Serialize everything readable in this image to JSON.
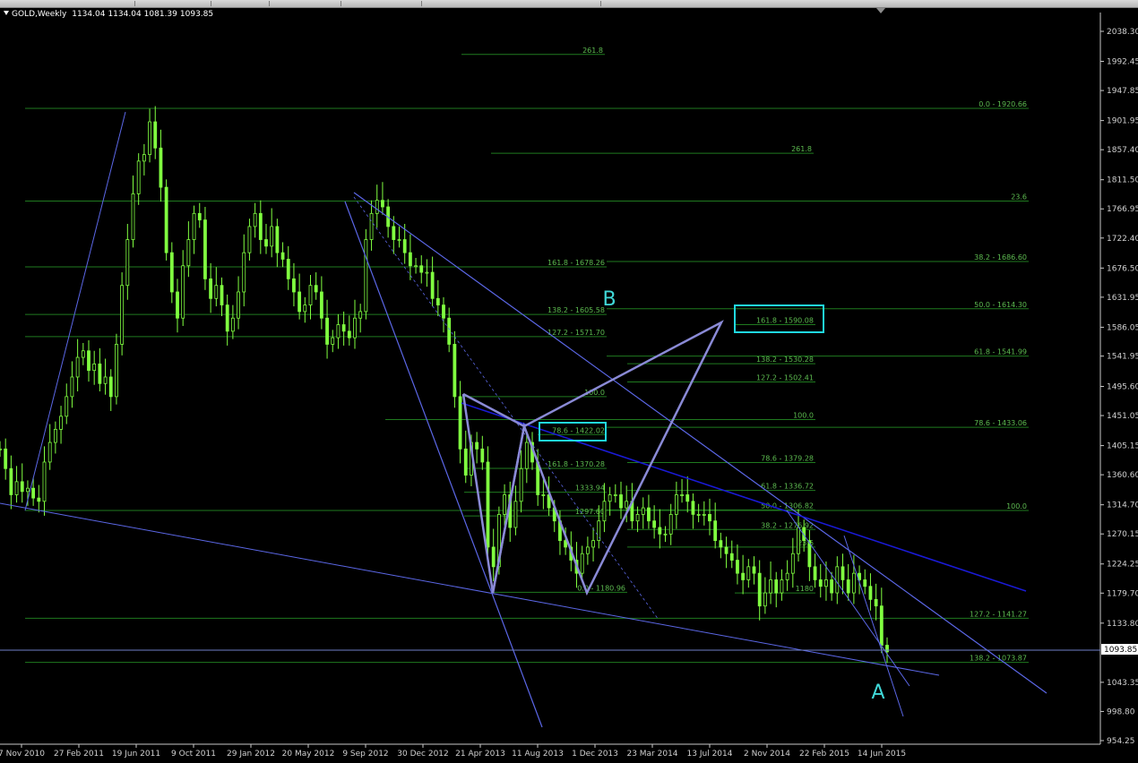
{
  "header": {
    "symbol": "GOLD,Weekly",
    "open": "1134.04",
    "high": "1134.04",
    "low": "1081.39",
    "close": "1093.85"
  },
  "colors": {
    "background": "#000000",
    "candles": "#80ff40",
    "fib": "#1f7a1f",
    "fib_text": "#5dbb50",
    "trendline": "#5b67e6",
    "trendline_dark": "#1a1ad6",
    "pattern": "#8a8ad6",
    "highlight_box": "#20d8e0",
    "label_text": "#40d8d8",
    "price_line": "#6f7fc8",
    "axis_text": "#d0d0d0"
  },
  "chart_data": {
    "type": "candlestick",
    "instrument": "GOLD",
    "timeframe": "Weekly",
    "ylim": [
      954.25,
      2050
    ],
    "y_ticks": [
      "2038.30",
      "1992.45",
      "1947.85",
      "1901.95",
      "1857.40",
      "1811.50",
      "1766.95",
      "1722.40",
      "1676.50",
      "1631.95",
      "1586.05",
      "1541.95",
      "1495.60",
      "1451.05",
      "1405.15",
      "1360.60",
      "1314.70",
      "1270.15",
      "1224.25",
      "1179.70",
      "1133.80",
      "1093.85",
      "1043.35",
      "998.80",
      "954.25"
    ],
    "x_ticks": [
      "7 Nov 2010",
      "27 Feb 2011",
      "19 Jun 2011",
      "9 Oct 2011",
      "29 Jan 2012",
      "20 May 2012",
      "9 Sep 2012",
      "30 Dec 2012",
      "21 Apr 2013",
      "11 Aug 2013",
      "1 Dec 2013",
      "23 Mar 2014",
      "13 Jul 2014",
      "2 Nov 2014",
      "22 Feb 2015",
      "14 Jun 2015"
    ],
    "current_price": "1093.85",
    "series": [
      {
        "values": [
          1400,
          1370,
          1330,
          1350,
          1335,
          1340,
          1325,
          1320,
          1380,
          1410,
          1430,
          1450,
          1480,
          1510,
          1540,
          1550,
          1520,
          1530,
          1500,
          1510,
          1480,
          1560,
          1650,
          1720,
          1790,
          1840,
          1850,
          1900,
          1860,
          1800,
          1700,
          1640,
          1600,
          1680,
          1720,
          1760,
          1750,
          1660,
          1630,
          1650,
          1620,
          1580,
          1600,
          1640,
          1700,
          1740,
          1760,
          1720,
          1710,
          1740,
          1700,
          1690,
          1660,
          1640,
          1610,
          1620,
          1650,
          1640,
          1600,
          1560,
          1570,
          1590,
          1580,
          1570,
          1600,
          1610,
          1720,
          1760,
          1780,
          1770,
          1740,
          1720,
          1720,
          1700,
          1680,
          1680,
          1670,
          1670,
          1630,
          1620,
          1600,
          1560,
          1480,
          1400,
          1360,
          1410,
          1400,
          1380,
          1250,
          1220,
          1300,
          1330,
          1280,
          1320,
          1370,
          1410,
          1380,
          1330,
          1330,
          1310,
          1290,
          1260,
          1250,
          1230,
          1210,
          1240,
          1250,
          1260,
          1290,
          1320,
          1330,
          1330,
          1310,
          1320,
          1290,
          1300,
          1310,
          1290,
          1280,
          1270,
          1270,
          1300,
          1330,
          1330,
          1320,
          1300,
          1300,
          1300,
          1290,
          1260,
          1250,
          1240,
          1230,
          1210,
          1200,
          1220,
          1210,
          1160,
          1180,
          1200,
          1180,
          1200,
          1210,
          1240,
          1280,
          1260,
          1220,
          1200,
          1190,
          1200,
          1180,
          1220,
          1200,
          1180,
          1210,
          1200,
          1190,
          1170,
          1160,
          1100,
          1090
        ]
      }
    ],
    "fib_levels": [
      {
        "label": "261.8",
        "price": 2003
      },
      {
        "label": "0.0 - 1920.66",
        "price": 1920.66
      },
      {
        "label": "261.8",
        "price": 1852
      },
      {
        "label": "23.6",
        "price": 1779
      },
      {
        "label": "161.8 - 1678.26",
        "price": 1678.26
      },
      {
        "label": "38.2 - 1686.60",
        "price": 1686.6
      },
      {
        "label": "138.2 - 1605.58",
        "price": 1605.58
      },
      {
        "label": "50.0 - 1614.30",
        "price": 1614.3
      },
      {
        "label": "161.8 - 1590.08",
        "price": 1590.08
      },
      {
        "label": "127.2 - 1571.70",
        "price": 1571.7
      },
      {
        "label": "61.8 - 1541.99",
        "price": 1541.99
      },
      {
        "label": "138.2 - 1530.28",
        "price": 1530.28
      },
      {
        "label": "127.2 - 1502.41",
        "price": 1502.41
      },
      {
        "label": "100.0",
        "price": 1480
      },
      {
        "label": "100.0",
        "price": 1445
      },
      {
        "label": "78.6 - 1433.06",
        "price": 1433.06
      },
      {
        "label": "78.6 - 1422.02",
        "price": 1422.02
      },
      {
        "label": "78.6 - 1379.28",
        "price": 1379.28
      },
      {
        "label": "161.8 - 1370.28",
        "price": 1370.28
      },
      {
        "label": "61.8 - 1336.72",
        "price": 1336.72
      },
      {
        "label": "1333.94",
        "price": 1333.94
      },
      {
        "label": "50.0 - 1306.82",
        "price": 1306.82
      },
      {
        "label": "100.0",
        "price": 1306
      },
      {
        "label": "1297.60",
        "price": 1297.6
      },
      {
        "label": "38.2 - 1276.92",
        "price": 1276.92
      },
      {
        "label": "23.6",
        "price": 1250
      },
      {
        "label": "0.0 - 1180.96",
        "price": 1180.96
      },
      {
        "label": "1180",
        "price": 1180
      },
      {
        "label": "127.2 - 1141.27",
        "price": 1141.27
      },
      {
        "label": "138.2 - 1073.87",
        "price": 1073.87
      }
    ],
    "pattern_labels": [
      "B",
      "A"
    ],
    "highlighted_levels": [
      "78.6 - 1422.02",
      "161.8 - 1590.08"
    ]
  }
}
